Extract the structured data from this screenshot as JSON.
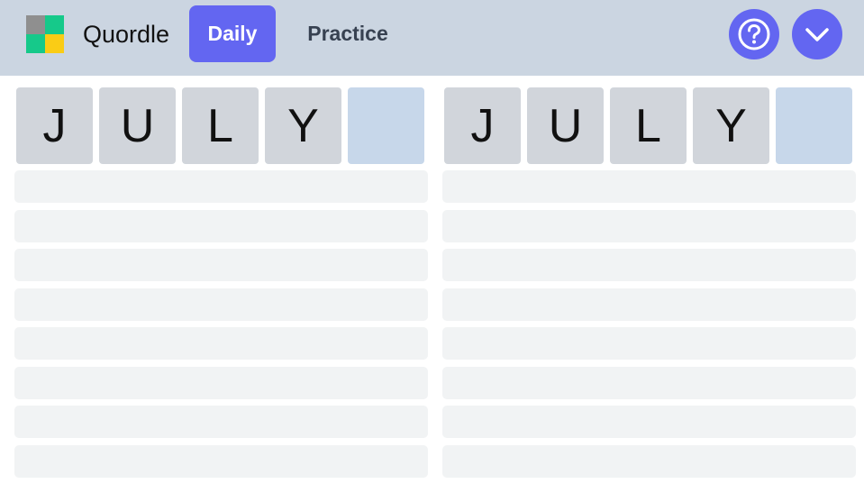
{
  "header": {
    "app_title": "Quordle",
    "tabs": [
      {
        "label": "Daily",
        "active": true
      },
      {
        "label": "Practice",
        "active": false
      }
    ],
    "icons": {
      "help": "question-circle-icon",
      "menu": "chevron-down-icon"
    }
  },
  "boards": [
    {
      "current_row": [
        "J",
        "U",
        "L",
        "Y",
        ""
      ],
      "empty_rows": 8
    },
    {
      "current_row": [
        "J",
        "U",
        "L",
        "Y",
        ""
      ],
      "empty_rows": 8
    }
  ],
  "colors": {
    "header_bg": "#cbd5e1",
    "accent": "#6366f1",
    "tile": "#d1d5db",
    "tile_active": "#c7d7ea",
    "empty_row": "#f1f3f4",
    "logo": [
      "#8f8f8f",
      "#16c98a",
      "#16c98a",
      "#facc15"
    ]
  }
}
